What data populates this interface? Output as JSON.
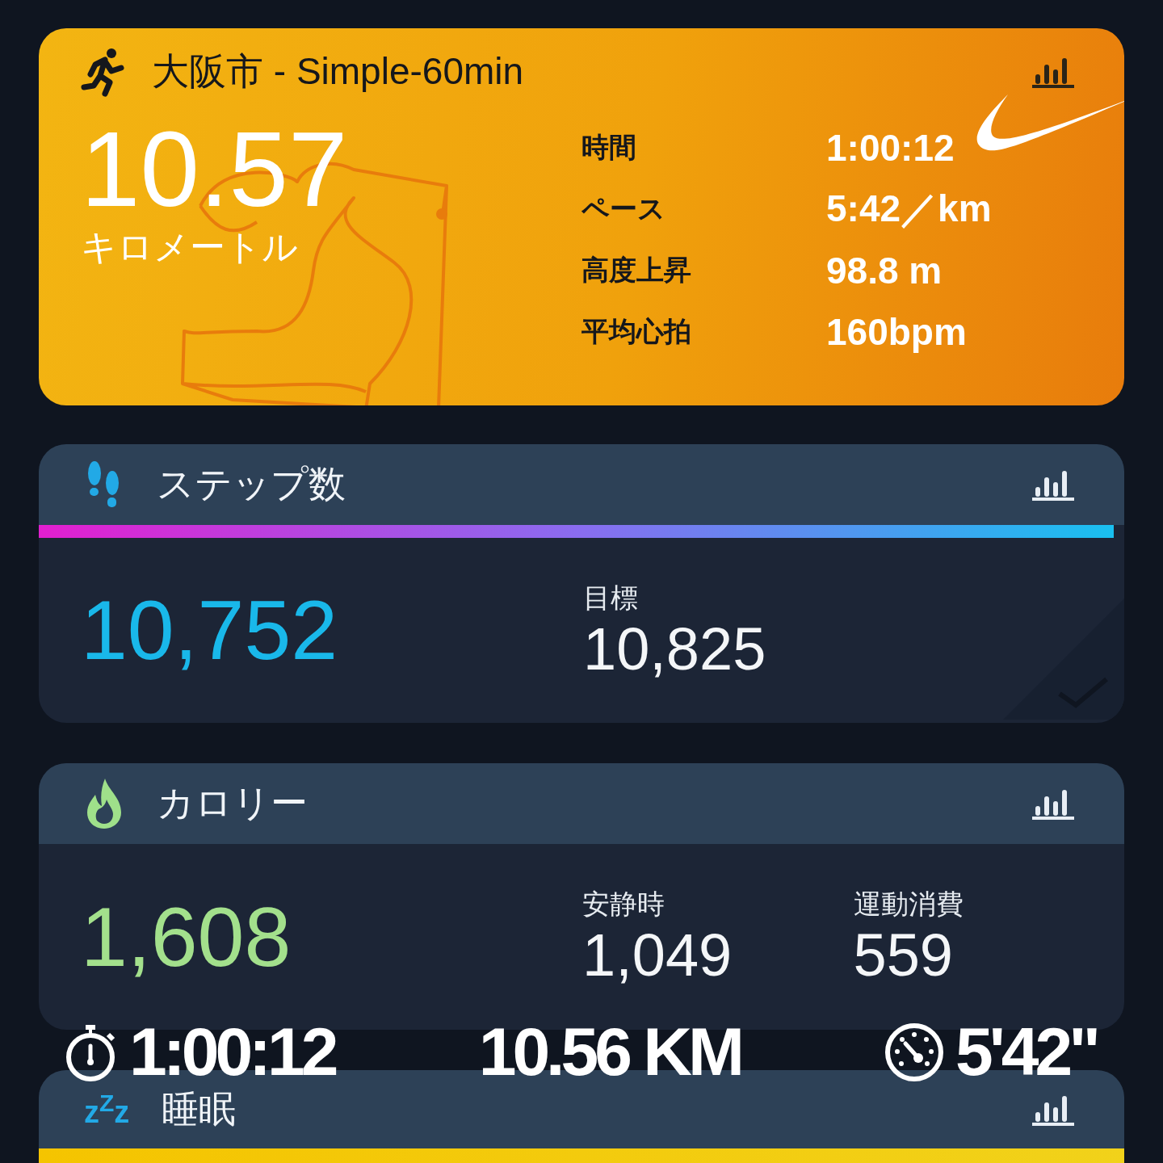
{
  "activity": {
    "title": "大阪市 - Simple-60min",
    "distance": "10.57",
    "unit": "キロメートル",
    "stats": [
      {
        "label": "時間",
        "value": "1:00:12"
      },
      {
        "label": "ペース",
        "value": "5:42／km"
      },
      {
        "label": "高度上昇",
        "value": "98.8 m"
      },
      {
        "label": "平均心拍",
        "value": "160bpm"
      }
    ]
  },
  "steps": {
    "title": "ステップ数",
    "value": "10,752",
    "goal_label": "目標",
    "goal": "10,825",
    "level": 0.99
  },
  "calories": {
    "title": "カロリー",
    "value": "1,608",
    "parts": [
      {
        "label": "安静時",
        "value": "1,049"
      },
      {
        "label": "運動消費",
        "value": "559"
      }
    ]
  },
  "overlay": {
    "time": "1:00:12",
    "distance": "10.56 KM",
    "pace": "5'42\""
  },
  "sleep": {
    "title": "睡眠",
    "icon": "z$^{Z}$z"
  }
}
